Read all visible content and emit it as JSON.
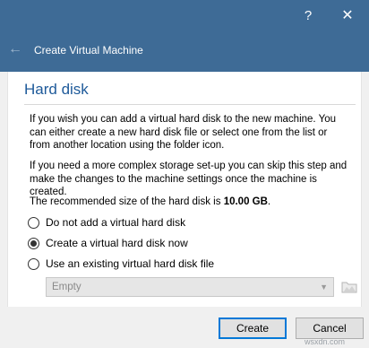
{
  "window": {
    "help_label": "?",
    "close_label": "✕",
    "back_icon": "←",
    "title": "Create Virtual Machine"
  },
  "page": {
    "title": "Hard disk",
    "paragraph1": "If you wish you can add a virtual hard disk to the new machine. You can either create a new hard disk file or select one from the list or from another location using the folder icon.",
    "paragraph2": "If you need a more complex storage set-up you can skip this step and make the changes to the machine settings once the machine is created.",
    "recommended_prefix": "The recommended size of the hard disk is ",
    "recommended_size": "10.00 GB",
    "recommended_suffix": "."
  },
  "options": [
    {
      "label": "Do not add a virtual hard disk",
      "selected": false
    },
    {
      "label": "Create a virtual hard disk now",
      "selected": true
    },
    {
      "label": "Use an existing virtual hard disk file",
      "selected": false
    }
  ],
  "existing_disk_select": {
    "value": "Empty",
    "enabled": false
  },
  "buttons": {
    "create": "Create",
    "cancel": "Cancel"
  },
  "watermark": "wsxdn.com",
  "colors": {
    "titlebar": "#3e6b96",
    "page_title": "#1e5a9a",
    "default_button_border": "#0078d7"
  }
}
